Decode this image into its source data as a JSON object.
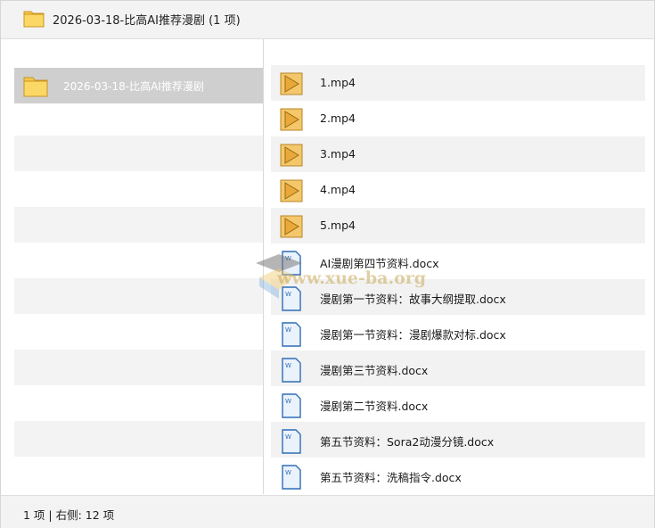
{
  "window": {
    "title": "2026-03-18-比高AI推荐漫剧 (1 项)",
    "title_icon": "folder-icon"
  },
  "left_pane": {
    "items": [
      {
        "label": "2026-03-18-比高AI推荐漫剧",
        "icon": "folder-icon",
        "selected": true
      }
    ]
  },
  "right_pane": {
    "files": [
      {
        "name": "1.mp4",
        "icon": "video-file-icon"
      },
      {
        "name": "2.mp4",
        "icon": "video-file-icon"
      },
      {
        "name": "3.mp4",
        "icon": "video-file-icon"
      },
      {
        "name": "4.mp4",
        "icon": "video-file-icon"
      },
      {
        "name": "5.mp4",
        "icon": "video-file-icon"
      },
      {
        "name": "AI漫剧第四节资料.docx",
        "icon": "docx-file-icon"
      },
      {
        "name": "漫剧第一节资料：故事大纲提取.docx",
        "icon": "docx-file-icon"
      },
      {
        "name": "漫剧第一节资料：漫剧爆款对标.docx",
        "icon": "docx-file-icon"
      },
      {
        "name": "漫剧第三节资料.docx",
        "icon": "docx-file-icon"
      },
      {
        "name": "漫剧第二节资料.docx",
        "icon": "docx-file-icon"
      },
      {
        "name": "第五节资料：Sora2动漫分镜.docx",
        "icon": "docx-file-icon"
      },
      {
        "name": "第五节资料：洗稿指令.docx",
        "icon": "docx-file-icon"
      }
    ]
  },
  "status_bar": {
    "text": "1 项 | 右侧: 12 项"
  },
  "watermark": {
    "text": "www.xue-ba.org"
  },
  "colors": {
    "folder": "#f5c84c",
    "video_icon": "#e9a93a",
    "doc_icon": "#2f6db5",
    "selected_row": "#cfcfcf",
    "stripe": "#f2f2f2"
  }
}
